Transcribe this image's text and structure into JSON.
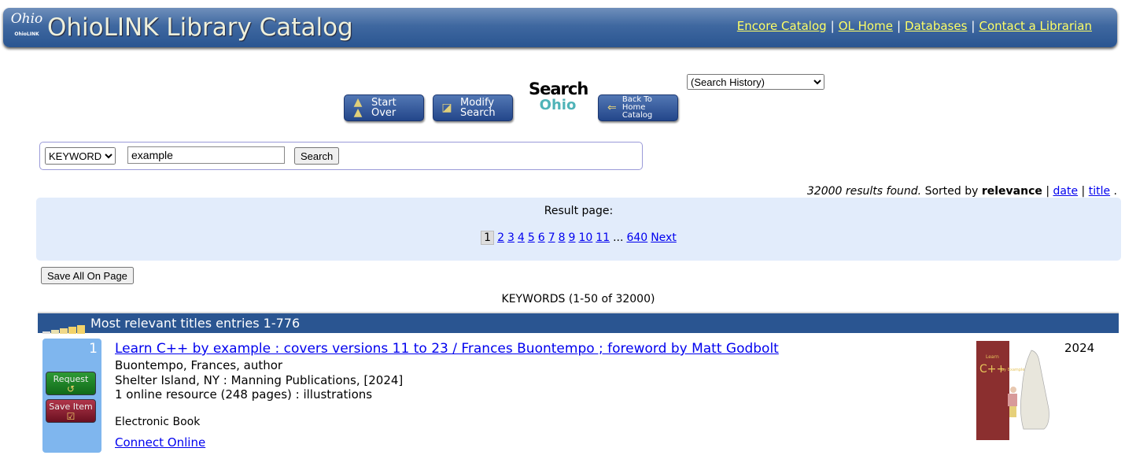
{
  "header": {
    "logo_text": "Ohio",
    "logo_sub": "OhioLINK",
    "title": "OhioLINK Library Catalog",
    "links": [
      "Encore Catalog",
      "OL Home",
      "Databases",
      "Contact a Librarian"
    ],
    "link_color": "#ffff66",
    "bar_color": "#2a5591"
  },
  "toolbar": {
    "history_select": "(Search History)",
    "start_over": [
      "Start",
      "Over"
    ],
    "modify_search": [
      "Modify",
      "Search"
    ],
    "search_ohio": [
      "Search",
      "Ohio"
    ],
    "back_home": [
      "Back To Home",
      "Catalog"
    ]
  },
  "search": {
    "type": "KEYWORD",
    "query": "example",
    "button": "Search"
  },
  "results": {
    "count_text": "32000 results found.",
    "sorted_by": "Sorted by",
    "sort_current": "relevance",
    "sort_options": [
      "date",
      "title"
    ],
    "page_label": "Result page:",
    "current_page": "1",
    "pages": [
      "2",
      "3",
      "4",
      "5",
      "6",
      "7",
      "8",
      "9",
      "10",
      "11"
    ],
    "ellipsis": "...",
    "last_page": "640",
    "next": "Next",
    "save_all": "Save All On Page",
    "keywords_range": "KEYWORDS (1-50 of 32000)",
    "section_title": "Most relevant titles entries 1-776"
  },
  "items": [
    {
      "number": "1",
      "request": "Request",
      "save": "Save Item",
      "title": "Learn C++ by example : covers versions 11 to 23 / Frances Buontempo ; foreword by Matt Godbolt",
      "author": "Buontempo, Frances, author",
      "publication": "Shelter Island, NY : Manning Publications, [2024]",
      "description": "1 online resource (248 pages) : illustrations",
      "format": "Electronic Book",
      "link": "Connect Online",
      "year": "2024",
      "cover_text": [
        "Learn",
        "C++ by Example"
      ]
    }
  ]
}
